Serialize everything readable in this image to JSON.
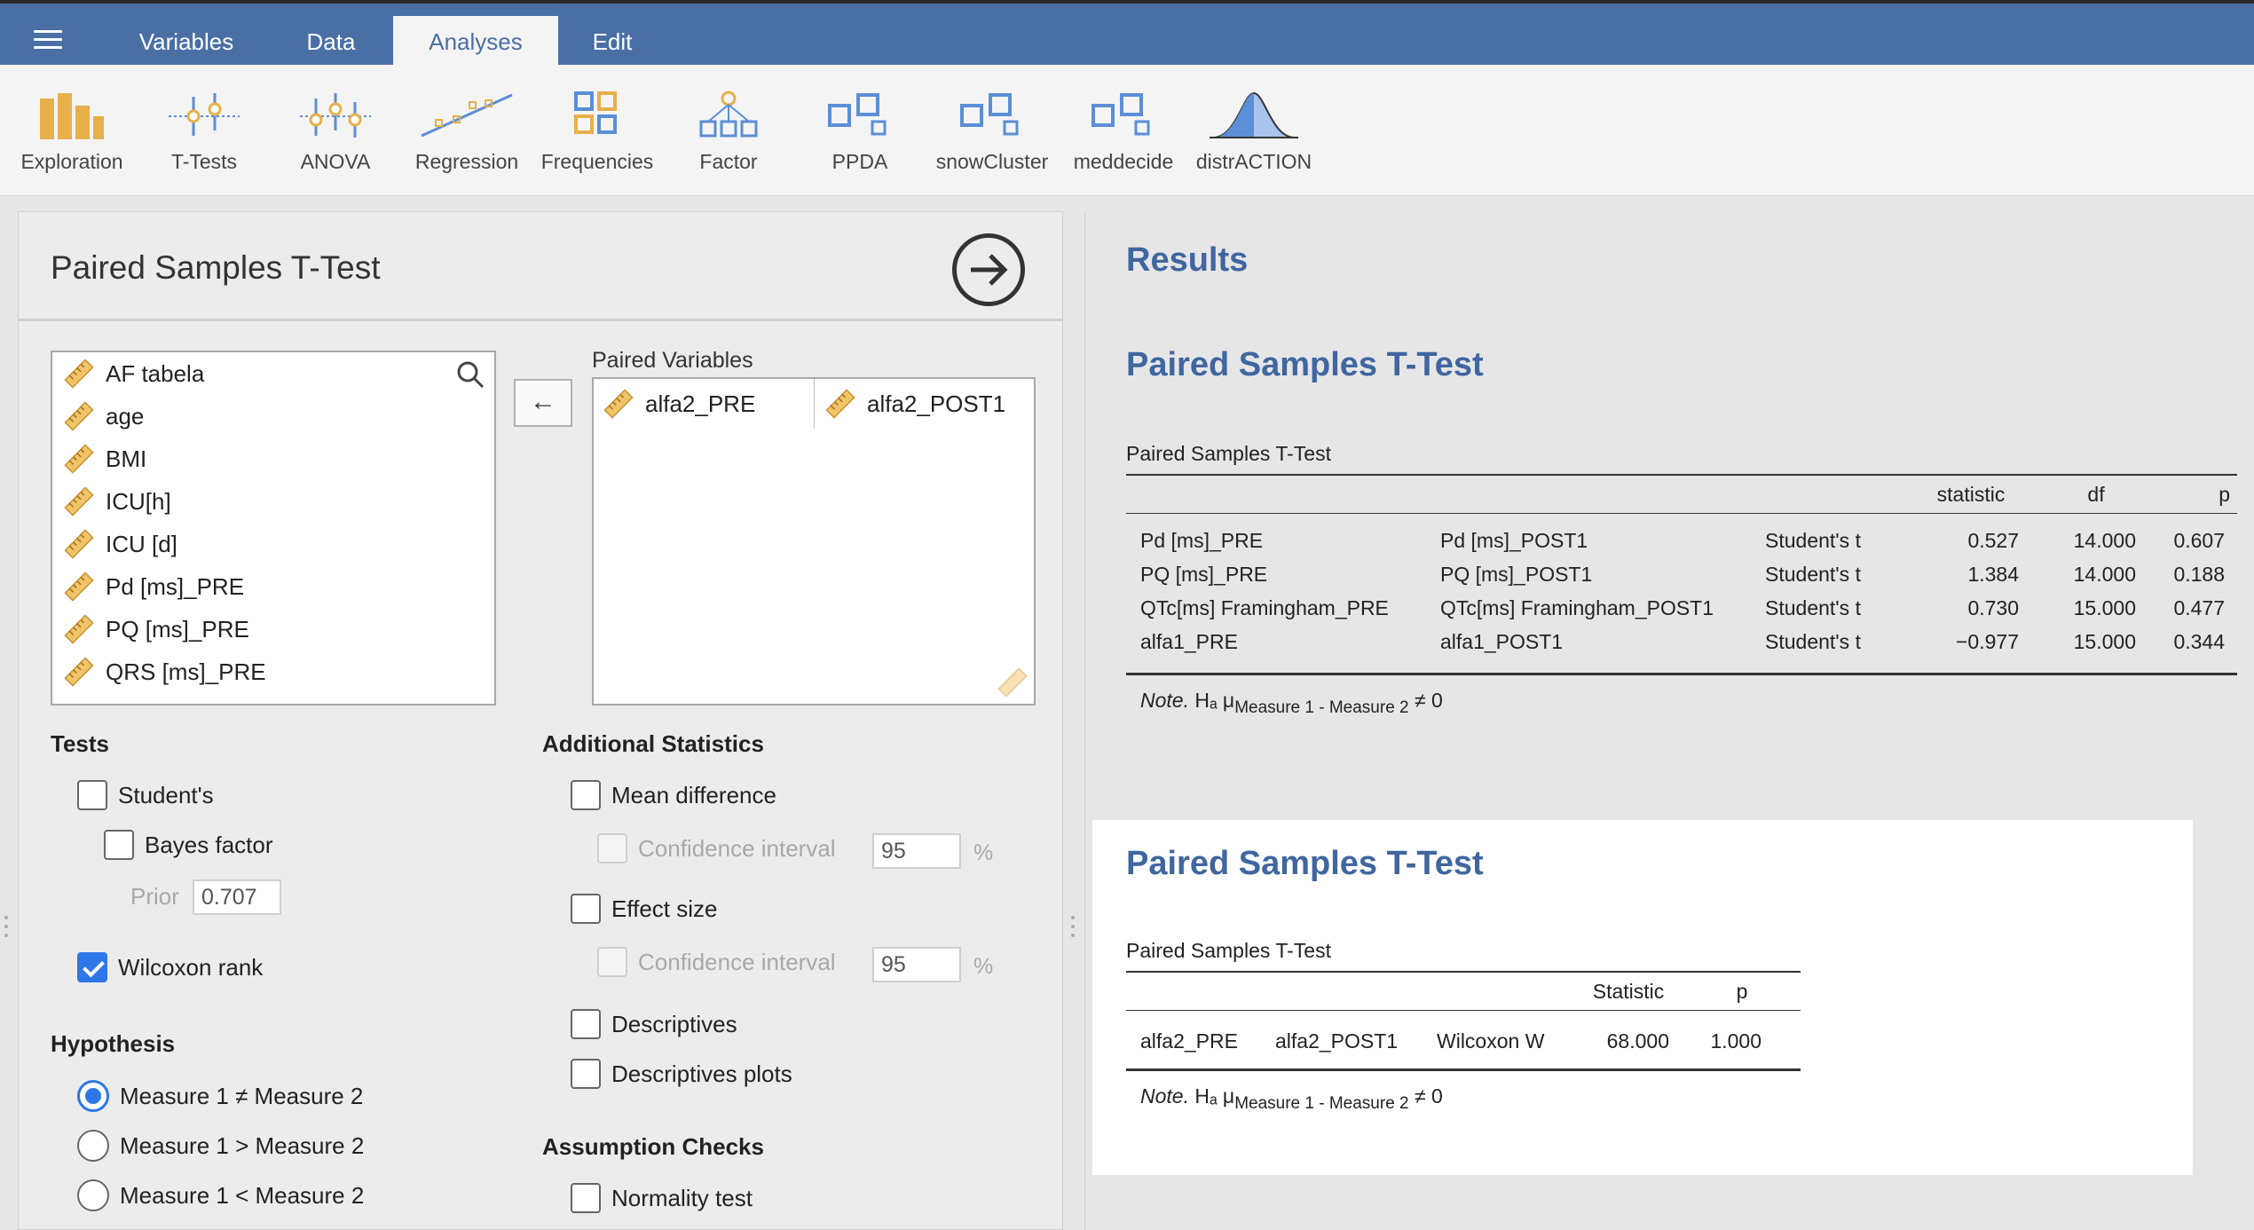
{
  "menu": {
    "tabs": [
      {
        "label": "Variables"
      },
      {
        "label": "Data"
      },
      {
        "label": "Analyses"
      },
      {
        "label": "Edit"
      }
    ],
    "active_tab": "Analyses"
  },
  "ribbon": {
    "buttons": [
      {
        "label": "Exploration",
        "icon": "exploration-icon"
      },
      {
        "label": "T-Tests",
        "icon": "ttests-icon"
      },
      {
        "label": "ANOVA",
        "icon": "anova-icon"
      },
      {
        "label": "Regression",
        "icon": "regression-icon"
      },
      {
        "label": "Frequencies",
        "icon": "frequencies-icon"
      },
      {
        "label": "Factor",
        "icon": "factor-icon"
      },
      {
        "label": "PPDA",
        "icon": "ppda-icon"
      },
      {
        "label": "snowCluster",
        "icon": "snowcluster-icon"
      },
      {
        "label": "meddecide",
        "icon": "meddecide-icon"
      },
      {
        "label": "distrACTION",
        "icon": "distraction-icon"
      }
    ]
  },
  "options": {
    "title": "Paired Samples T-Test",
    "variables": [
      "AF tabela",
      "age",
      "BMI",
      "ICU[h]",
      "ICU [d]",
      "Pd [ms]_PRE",
      "PQ [ms]_PRE",
      "QRS [ms]_PRE"
    ],
    "paired_label": "Paired Variables",
    "paired": {
      "left": "alfa2_PRE",
      "right": "alfa2_POST1"
    },
    "move_arrow": "←",
    "tests": {
      "heading": "Tests",
      "students": "Student's",
      "bayes": "Bayes factor",
      "prior_label": "Prior",
      "prior_value": "0.707",
      "wilcoxon": "Wilcoxon rank"
    },
    "hypothesis": {
      "heading": "Hypothesis",
      "ne": "Measure 1 ≠ Measure 2",
      "gt": "Measure 1 > Measure 2",
      "lt": "Measure 1 < Measure 2"
    },
    "additional": {
      "heading": "Additional Statistics",
      "mean_diff": "Mean difference",
      "ci1": "Confidence interval",
      "ci1_value": "95",
      "effect_size": "Effect size",
      "ci2": "Confidence interval",
      "ci2_value": "95",
      "pct": "%",
      "descriptives": "Descriptives",
      "descriptives_plots": "Descriptives plots"
    },
    "assumptions": {
      "heading": "Assumption Checks",
      "normality": "Normality test"
    }
  },
  "results": {
    "title": "Results",
    "analysis1": {
      "heading": "Paired Samples T-Test",
      "table_title": "Paired Samples T-Test",
      "columns": [
        "statistic",
        "df",
        "p"
      ],
      "rows": [
        {
          "m1": "Pd [ms]_PRE",
          "m2": "Pd [ms]_POST1",
          "test": "Student's t",
          "stat": "0.527",
          "df": "14.000",
          "p": "0.607"
        },
        {
          "m1": "PQ [ms]_PRE",
          "m2": "PQ [ms]_POST1",
          "test": "Student's t",
          "stat": "1.384",
          "df": "14.000",
          "p": "0.188"
        },
        {
          "m1": "QTc[ms] Framingham_PRE",
          "m2": "QTc[ms] Framingham_POST1",
          "test": "Student's t",
          "stat": "0.730",
          "df": "15.000",
          "p": "0.477"
        },
        {
          "m1": "alfa1_PRE",
          "m2": "alfa1_POST1",
          "test": "Student's t",
          "stat": "−0.977",
          "df": "15.000",
          "p": "0.344"
        }
      ],
      "note_label": "Note.",
      "note_h": "Hₐ μ",
      "note_sub": "Measure 1 - Measure 2",
      "note_tail": " ≠ 0"
    },
    "analysis2": {
      "heading": "Paired Samples T-Test",
      "table_title": "Paired Samples T-Test",
      "columns": [
        "Statistic",
        "p"
      ],
      "row": {
        "m1": "alfa2_PRE",
        "m2": "alfa2_POST1",
        "test": "Wilcoxon W",
        "stat": "68.000",
        "p": "1.000"
      },
      "note_label": "Note.",
      "note_h": "Hₐ μ",
      "note_sub": "Measure 1 - Measure 2",
      "note_tail": " ≠ 0"
    }
  },
  "colors": {
    "menubar": "#4a6fa5",
    "accent": "#2f76e8",
    "heading": "#3f66a0",
    "ribbon_icon_blue": "#5b8ed6",
    "ribbon_icon_gold": "#e8b04a"
  }
}
